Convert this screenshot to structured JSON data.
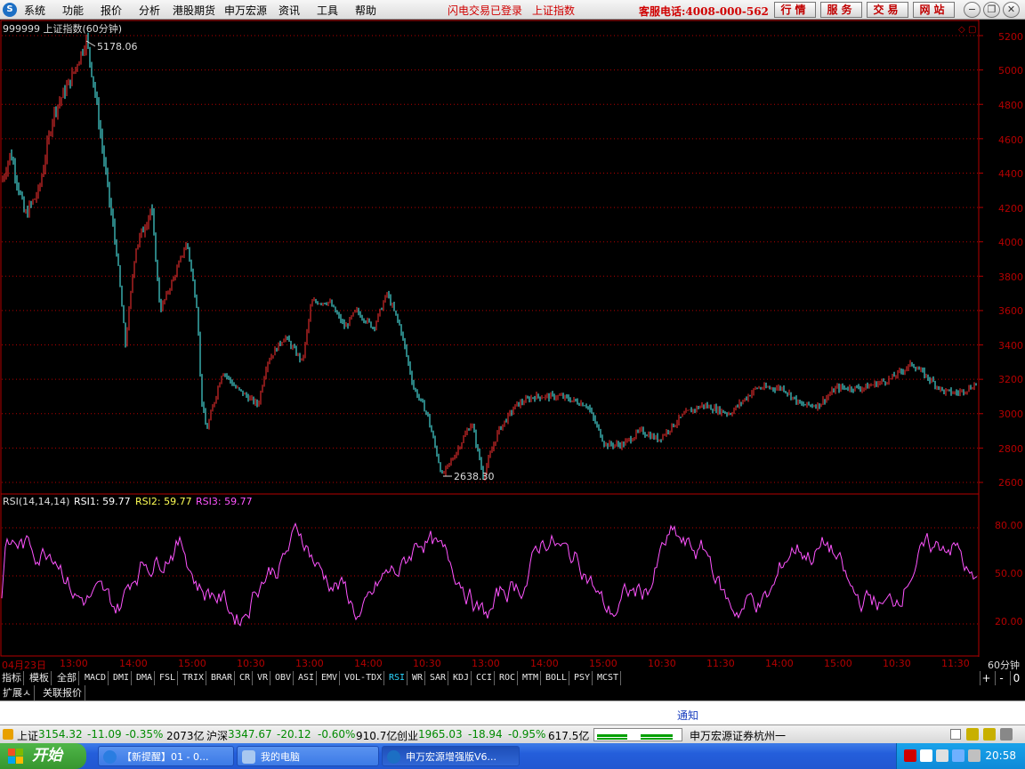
{
  "menu": {
    "items": [
      "系统",
      "功能",
      "报价",
      "分析",
      "港股期货",
      "申万宏源",
      "资讯",
      "工具",
      "帮助"
    ],
    "login_status": "闪电交易已登录",
    "index_name": "上证指数",
    "hotline": "客服电话:4008-000-562",
    "buttons": [
      "行情",
      "服务",
      "交易",
      "网站"
    ]
  },
  "chart": {
    "title": "999999 上证指数(60分钟)",
    "high_label": "5178.06",
    "low_label": "2638.30",
    "price_axis": [
      "5200",
      "5000",
      "4800",
      "4600",
      "4400",
      "4200",
      "4000",
      "3800",
      "3600",
      "3400",
      "3200",
      "3000",
      "2800",
      "2600"
    ],
    "rsi_header": {
      "name": "RSI(14,14,14)",
      "rsi1": "RSI1: 59.77",
      "rsi2": "RSI2: 59.77",
      "rsi3": "RSI3: 59.77"
    },
    "rsi_axis": [
      "80.00",
      "50.00",
      "20.00"
    ],
    "colors": {
      "up": "#ff3232",
      "down": "#54ffff",
      "rsi1": "#ffffff",
      "rsi2": "#ffff54",
      "rsi3": "#ff54ff",
      "grid": "#b40000"
    }
  },
  "time_axis": {
    "labels": [
      "04月23日",
      "13:00",
      "14:00",
      "15:00",
      "10:30",
      "13:00",
      "14:00",
      "10:30",
      "13:00",
      "14:00",
      "15:00",
      "10:30",
      "11:30",
      "14:00",
      "15:00",
      "10:30",
      "11:30"
    ],
    "period": "60分钟"
  },
  "indicator_tabs": [
    "指标",
    "模板",
    "全部",
    "MACD",
    "DMI",
    "DMA",
    "FSL",
    "TRIX",
    "BRAR",
    "CR",
    "VR",
    "OBV",
    "ASI",
    "EMV",
    "VOL-TDX",
    "RSI",
    "WR",
    "SAR",
    "KDJ",
    "CCI",
    "ROC",
    "MTM",
    "BOLL",
    "PSY",
    "MCST"
  ],
  "active_tab": "RSI",
  "zoom_buttons": [
    "+",
    "-",
    "0"
  ],
  "sub_tabs": [
    "扩展ㅅ",
    "关联报价"
  ],
  "notice": "通知",
  "status": {
    "sh_label": "上证",
    "sh_value": "3154.32",
    "sh_change": "-11.09",
    "sh_pct": "-0.35%",
    "sh_amount": "2073亿",
    "hs_label": "沪深",
    "hs_value": "3347.67",
    "hs_change": "-20.12",
    "hs_pct": "-0.60%",
    "hs_amount": "910.7亿",
    "cy_label": "创业",
    "cy_value": "1965.03",
    "cy_change": "-18.94",
    "cy_pct": "-0.95%",
    "cy_amount": "617.5亿",
    "broker": "申万宏源证券杭州一"
  },
  "taskbar": {
    "start_label": "开始",
    "tasks": [
      "【新提醒】01 - 0...",
      "我的电脑",
      "申万宏源增强版V6..."
    ],
    "clock": "20:58"
  }
}
